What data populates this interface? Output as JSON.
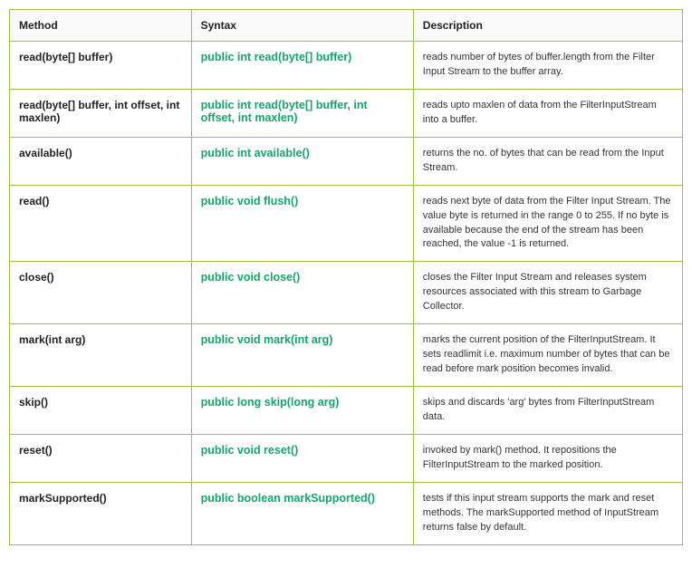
{
  "headers": {
    "method": "Method",
    "syntax": "Syntax",
    "description": "Description"
  },
  "rows": [
    {
      "method": "read(byte[] buffer)",
      "syntax": "public int read(byte[] buffer)",
      "description": "reads number of bytes of buffer.length from the Filter Input Stream to the buffer array."
    },
    {
      "method": "read(byte[] buffer, int offset, int maxlen)",
      "syntax": "public int read(byte[] buffer, int offset, int maxlen)",
      "description": "reads upto maxlen of data from the FilterInputStream into a buffer."
    },
    {
      "method": "available()",
      "syntax": "public int available()",
      "description": "returns the no. of bytes that can be read from the Input Stream."
    },
    {
      "method": "read()",
      "syntax": "public void flush()",
      "description": "reads next byte of data from the Filter Input Stream. The value byte is returned in the range 0 to 255. If no byte is available because the end of the stream has been reached, the value -1 is returned."
    },
    {
      "method": "close()",
      "syntax": "public void close()",
      "description": "closes the Filter Input Stream and releases system resources associated with this stream to Garbage Collector."
    },
    {
      "method": "mark(int arg)",
      "syntax": "public void mark(int arg)",
      "description": "marks the current position of the FilterInputStream. It sets readlimit i.e. maximum number of bytes that can be read before mark position becomes invalid."
    },
    {
      "method": "skip()",
      "syntax": "public long skip(long arg)",
      "description": "skips and discards 'arg' bytes from FilterInputStream data."
    },
    {
      "method": "reset()",
      "syntax": "public void reset()",
      "description": "invoked by mark() method. It repositions the FilterInputStream to the marked position."
    },
    {
      "method": "markSupported()",
      "syntax": "public boolean markSupported()",
      "description": "tests if this input stream supports the mark and reset methods. The markSupported method of InputStream returns false by default."
    }
  ]
}
